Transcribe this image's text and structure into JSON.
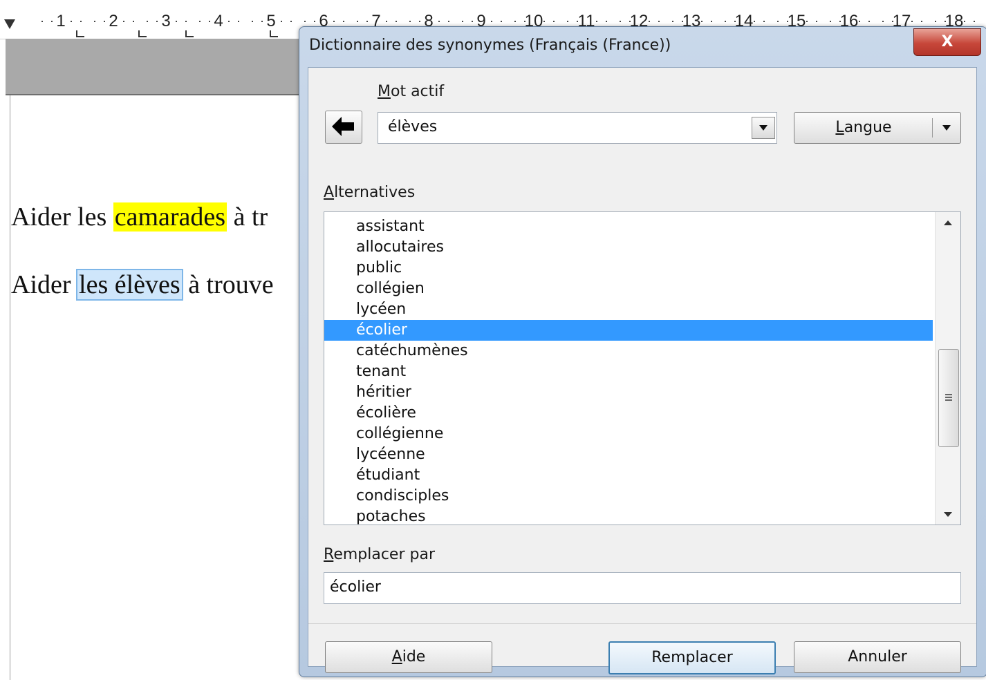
{
  "ruler": {
    "numbers": [
      "1",
      "2",
      "3",
      "4",
      "5",
      "6",
      "7",
      "8",
      "9",
      "10",
      "11",
      "12",
      "13",
      "14",
      "15",
      "16",
      "17",
      "18"
    ]
  },
  "document": {
    "line1": {
      "before": "Aider les ",
      "highlight": "camarades",
      "after": "  à tr"
    },
    "line2": {
      "before": "Aider ",
      "selected": "les élèves",
      "after": " à trouve"
    }
  },
  "dialog": {
    "title": "Dictionnaire des synonymes (Français (France))",
    "close_label": "X",
    "current_word": {
      "label_underlined": "M",
      "label_rest": "ot actif",
      "value": "élèves"
    },
    "language_button": {
      "label_underlined": "L",
      "label_rest": "angue"
    },
    "alternatives": {
      "label_underlined": "A",
      "label_rest": "lternatives",
      "items": [
        "assistant",
        "allocutaires",
        "public",
        "collégien",
        "lycéen",
        "écolier",
        "catéchumènes",
        "tenant",
        "héritier",
        "écolière",
        "collégienne",
        "lycéenne",
        "étudiant",
        "condisciples",
        "potaches"
      ],
      "selected_index": 5
    },
    "replace_with": {
      "label_underlined": "R",
      "label_rest": "emplacer par",
      "value": "écolier"
    },
    "buttons": {
      "help": {
        "label_underlined": "A",
        "label_rest": "ide"
      },
      "replace": "Remplacer",
      "cancel": "Annuler"
    }
  },
  "colors": {
    "selection": "#3399ff",
    "highlight_yellow": "#ffff00",
    "close_button": "#c7473a"
  }
}
